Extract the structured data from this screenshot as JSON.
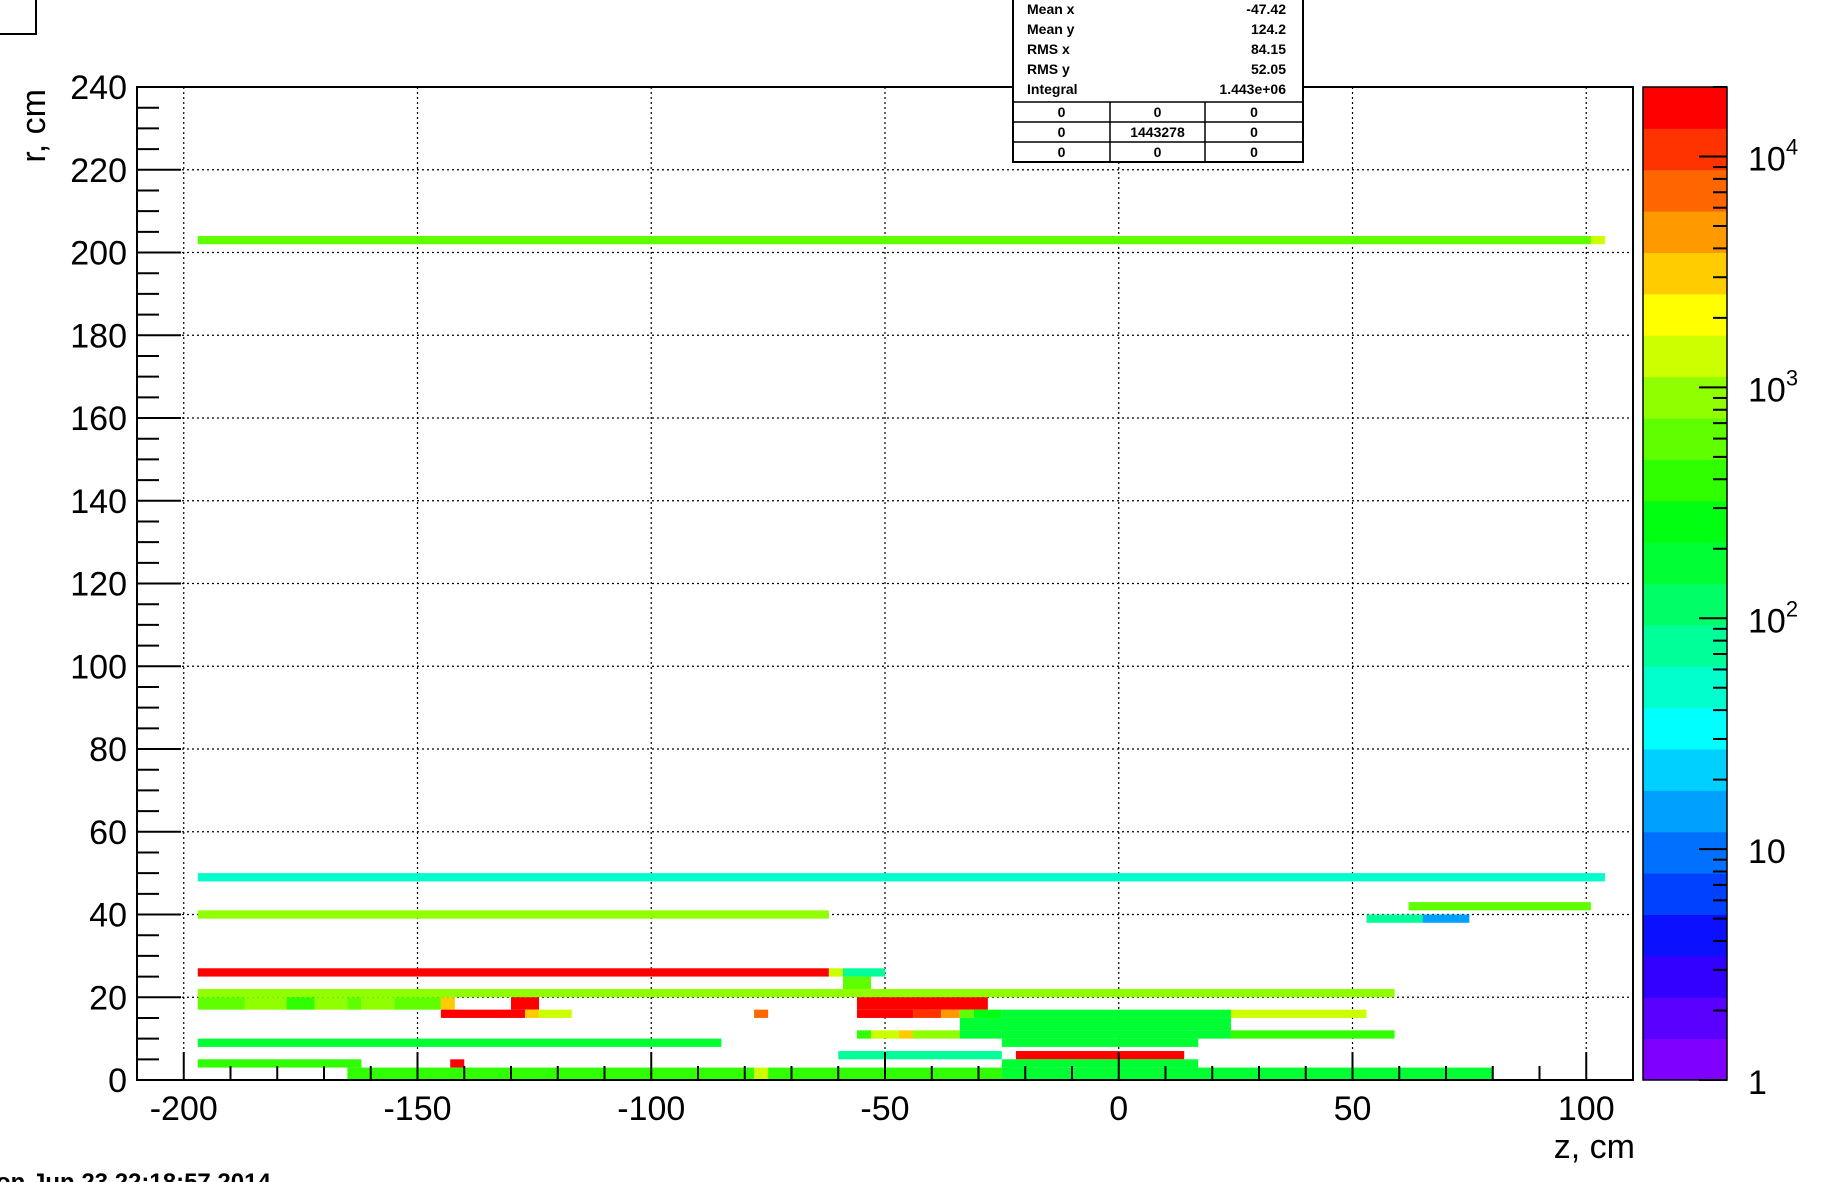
{
  "chart_data": {
    "type": "heatmap",
    "xlabel": "z, cm",
    "ylabel": "r, cm",
    "xlim": [
      -210,
      110
    ],
    "ylim": [
      0,
      240
    ],
    "x_ticks": [
      "-200",
      "-150",
      "-100",
      "-50",
      "0",
      "50",
      "100"
    ],
    "x_tick_values": [
      -200,
      -150,
      -100,
      -50,
      0,
      50,
      100
    ],
    "y_ticks": [
      "0",
      "20",
      "40",
      "60",
      "80",
      "100",
      "120",
      "140",
      "160",
      "180",
      "200",
      "220",
      "240"
    ],
    "y_tick_values": [
      0,
      20,
      40,
      60,
      80,
      100,
      120,
      140,
      160,
      180,
      200,
      220,
      240
    ],
    "grid": true,
    "colorbar": {
      "scale": "log",
      "range": [
        1,
        20000
      ],
      "labels": [
        {
          "value": 1,
          "base": "1",
          "exp": ""
        },
        {
          "value": 10,
          "base": "10",
          "exp": ""
        },
        {
          "value": 100,
          "base": "10",
          "exp": "2"
        },
        {
          "value": 1000,
          "base": "10",
          "exp": "3"
        },
        {
          "value": 10000,
          "base": "10",
          "exp": "4"
        }
      ],
      "colors": [
        "#7f00ff",
        "#5a00ff",
        "#3300ff",
        "#0b10ff",
        "#0040ff",
        "#0070ff",
        "#00a0ff",
        "#00d0ff",
        "#00ffff",
        "#00ffcc",
        "#00ff99",
        "#00ff66",
        "#00ff33",
        "#00ff10",
        "#30ff00",
        "#60ff00",
        "#90ff00",
        "#ccff00",
        "#ffff00",
        "#ffcc00",
        "#ff9900",
        "#ff6600",
        "#ff3300",
        "#ff0000"
      ]
    },
    "cells": [
      {
        "z0": -197,
        "z1": 101,
        "r0": 202,
        "r1": 204,
        "v": 600
      },
      {
        "z0": 101,
        "z1": 104,
        "r0": 202,
        "r1": 204,
        "v": 1500
      },
      {
        "z0": -197,
        "z1": 104,
        "r0": 48,
        "r1": 50,
        "v": 60
      },
      {
        "z0": -197,
        "z1": -62,
        "r0": 39,
        "r1": 41,
        "v": 1100
      },
      {
        "z0": 62,
        "z1": 101,
        "r0": 41,
        "r1": 43,
        "v": 600
      },
      {
        "z0": 53,
        "z1": 65,
        "r0": 38,
        "r1": 40,
        "v": 80
      },
      {
        "z0": 65,
        "z1": 75,
        "r0": 38,
        "r1": 40,
        "v": 12
      },
      {
        "z0": -197,
        "z1": -62,
        "r0": 25,
        "r1": 27,
        "v": 18000
      },
      {
        "z0": -62,
        "z1": -59,
        "r0": 25,
        "r1": 27,
        "v": 1200
      },
      {
        "z0": -59,
        "z1": -50,
        "r0": 25,
        "r1": 27,
        "v": 80
      },
      {
        "z0": -59,
        "z1": -53,
        "r0": 22,
        "r1": 25,
        "v": 500
      },
      {
        "z0": -197,
        "z1": 59,
        "r0": 20,
        "r1": 22,
        "v": 1100
      },
      {
        "z0": -197,
        "z1": -187,
        "r0": 17,
        "r1": 20,
        "v": 600
      },
      {
        "z0": -187,
        "z1": -178,
        "r0": 17,
        "r1": 20,
        "v": 1100
      },
      {
        "z0": -178,
        "z1": -172,
        "r0": 17,
        "r1": 20,
        "v": 400
      },
      {
        "z0": -172,
        "z1": -165,
        "r0": 17,
        "r1": 20,
        "v": 1100
      },
      {
        "z0": -165,
        "z1": -162,
        "r0": 17,
        "r1": 20,
        "v": 600
      },
      {
        "z0": -162,
        "z1": -155,
        "r0": 17,
        "r1": 20,
        "v": 1100
      },
      {
        "z0": -155,
        "z1": -145,
        "r0": 17,
        "r1": 20,
        "v": 600
      },
      {
        "z0": -145,
        "z1": -142,
        "r0": 17,
        "r1": 20,
        "v": 3500
      },
      {
        "z0": -145,
        "z1": -127,
        "r0": 15,
        "r1": 17,
        "v": 18000
      },
      {
        "z0": -130,
        "z1": -124,
        "r0": 17,
        "r1": 20,
        "v": 18000
      },
      {
        "z0": -127,
        "z1": -124,
        "r0": 15,
        "r1": 17,
        "v": 3500
      },
      {
        "z0": -124,
        "z1": -117,
        "r0": 15,
        "r1": 17,
        "v": 1500
      },
      {
        "z0": -78,
        "z1": -75,
        "r0": 15,
        "r1": 17,
        "v": 6000
      },
      {
        "z0": -56,
        "z1": -28,
        "r0": 17,
        "r1": 20,
        "v": 18000
      },
      {
        "z0": -56,
        "z1": -44,
        "r0": 15,
        "r1": 17,
        "v": 18000
      },
      {
        "z0": -44,
        "z1": -38,
        "r0": 15,
        "r1": 17,
        "v": 9000
      },
      {
        "z0": -38,
        "z1": -34,
        "r0": 15,
        "r1": 17,
        "v": 4000
      },
      {
        "z0": -34,
        "z1": -31,
        "r0": 15,
        "r1": 17,
        "v": 600
      },
      {
        "z0": -31,
        "z1": -25,
        "r0": 15,
        "r1": 17,
        "v": 250
      },
      {
        "z0": -25,
        "z1": 24,
        "r0": 15,
        "r1": 17,
        "v": 150
      },
      {
        "z0": 24,
        "z1": 53,
        "r0": 15,
        "r1": 17,
        "v": 1500
      },
      {
        "z0": -56,
        "z1": -53,
        "r0": 10,
        "r1": 12,
        "v": 400
      },
      {
        "z0": -53,
        "z1": -47,
        "r0": 10,
        "r1": 12,
        "v": 1500
      },
      {
        "z0": -47,
        "z1": -44,
        "r0": 10,
        "r1": 12,
        "v": 3500
      },
      {
        "z0": -44,
        "z1": -34,
        "r0": 10,
        "r1": 12,
        "v": 1100
      },
      {
        "z0": -34,
        "z1": -25,
        "r0": 10,
        "r1": 12,
        "v": 200
      },
      {
        "z0": -25,
        "z1": 24,
        "r0": 10,
        "r1": 12,
        "v": 150
      },
      {
        "z0": 24,
        "z1": 59,
        "r0": 10,
        "r1": 12,
        "v": 400
      },
      {
        "z0": -34,
        "z1": 24,
        "r0": 12,
        "r1": 15,
        "v": 150
      },
      {
        "z0": -197,
        "z1": -85,
        "r0": 8,
        "r1": 10,
        "v": 150
      },
      {
        "z0": -25,
        "z1": 17,
        "r0": 8,
        "r1": 10,
        "v": 150
      },
      {
        "z0": -60,
        "z1": -25,
        "r0": 5,
        "r1": 7,
        "v": 80
      },
      {
        "z0": -22,
        "z1": 14,
        "r0": 5,
        "r1": 7,
        "v": 18000
      },
      {
        "z0": -197,
        "z1": -162,
        "r0": 3,
        "r1": 5,
        "v": 400
      },
      {
        "z0": -143,
        "z1": -140,
        "r0": 3,
        "r1": 5,
        "v": 18000
      },
      {
        "z0": -25,
        "z1": 17,
        "r0": 3,
        "r1": 5,
        "v": 150
      },
      {
        "z0": -165,
        "z1": -78,
        "r0": 0,
        "r1": 3,
        "v": 400
      },
      {
        "z0": -78,
        "z1": -75,
        "r0": 0,
        "r1": 3,
        "v": 1500
      },
      {
        "z0": -75,
        "z1": -25,
        "r0": 0,
        "r1": 3,
        "v": 400
      },
      {
        "z0": -25,
        "z1": 80,
        "r0": 0,
        "r1": 3,
        "v": 150
      }
    ],
    "stats": {
      "rows": [
        {
          "label": "Mean x",
          "value": "-47.42"
        },
        {
          "label": "Mean y",
          "value": "124.2"
        },
        {
          "label": "RMS x",
          "value": "84.15"
        },
        {
          "label": "RMS y",
          "value": "52.05"
        },
        {
          "label": "Integral",
          "value": "1.443e+06"
        }
      ],
      "grid": [
        [
          "0",
          "0",
          "0"
        ],
        [
          "0",
          "1443278",
          "0"
        ],
        [
          "0",
          "0",
          "0"
        ]
      ]
    },
    "footer": "on Jun 23 22:18:57 2014"
  }
}
